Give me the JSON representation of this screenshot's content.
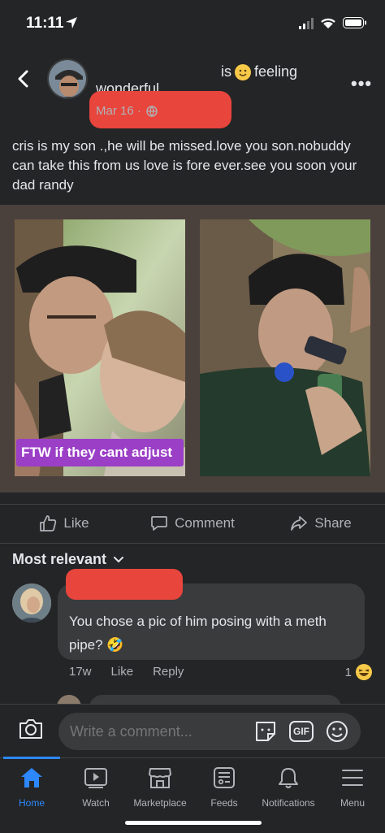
{
  "status": {
    "time": "11:11"
  },
  "post": {
    "feeling_text": "is",
    "feeling_word": "feeling",
    "feeling_continuation": "wonderful.",
    "date": "Mar 16 ·",
    "text": "cris is my son .,he will be missed.love you son.nobuddy can take this from us love is  fore ever.see you soon your dad randy",
    "photo_caption": "FTW if they cant adjust"
  },
  "actions": {
    "like": "Like",
    "comment": "Comment",
    "share": "Share"
  },
  "comments_sort": "Most relevant",
  "comment": {
    "text": "You chose a pic of him posing with a meth pipe? 🤣",
    "age": "17w",
    "like": "Like",
    "reply": "Reply",
    "reaction_count": "1"
  },
  "composer": {
    "placeholder": "Write a comment...",
    "gif_label": "GIF"
  },
  "tabs": [
    {
      "label": "Home"
    },
    {
      "label": "Watch"
    },
    {
      "label": "Marketplace"
    },
    {
      "label": "Feeds"
    },
    {
      "label": "Notifications"
    },
    {
      "label": "Menu"
    }
  ],
  "colors": {
    "accent": "#2d88ff",
    "redaction": "#e8453c",
    "caption_bg": "#9b3fc7"
  }
}
